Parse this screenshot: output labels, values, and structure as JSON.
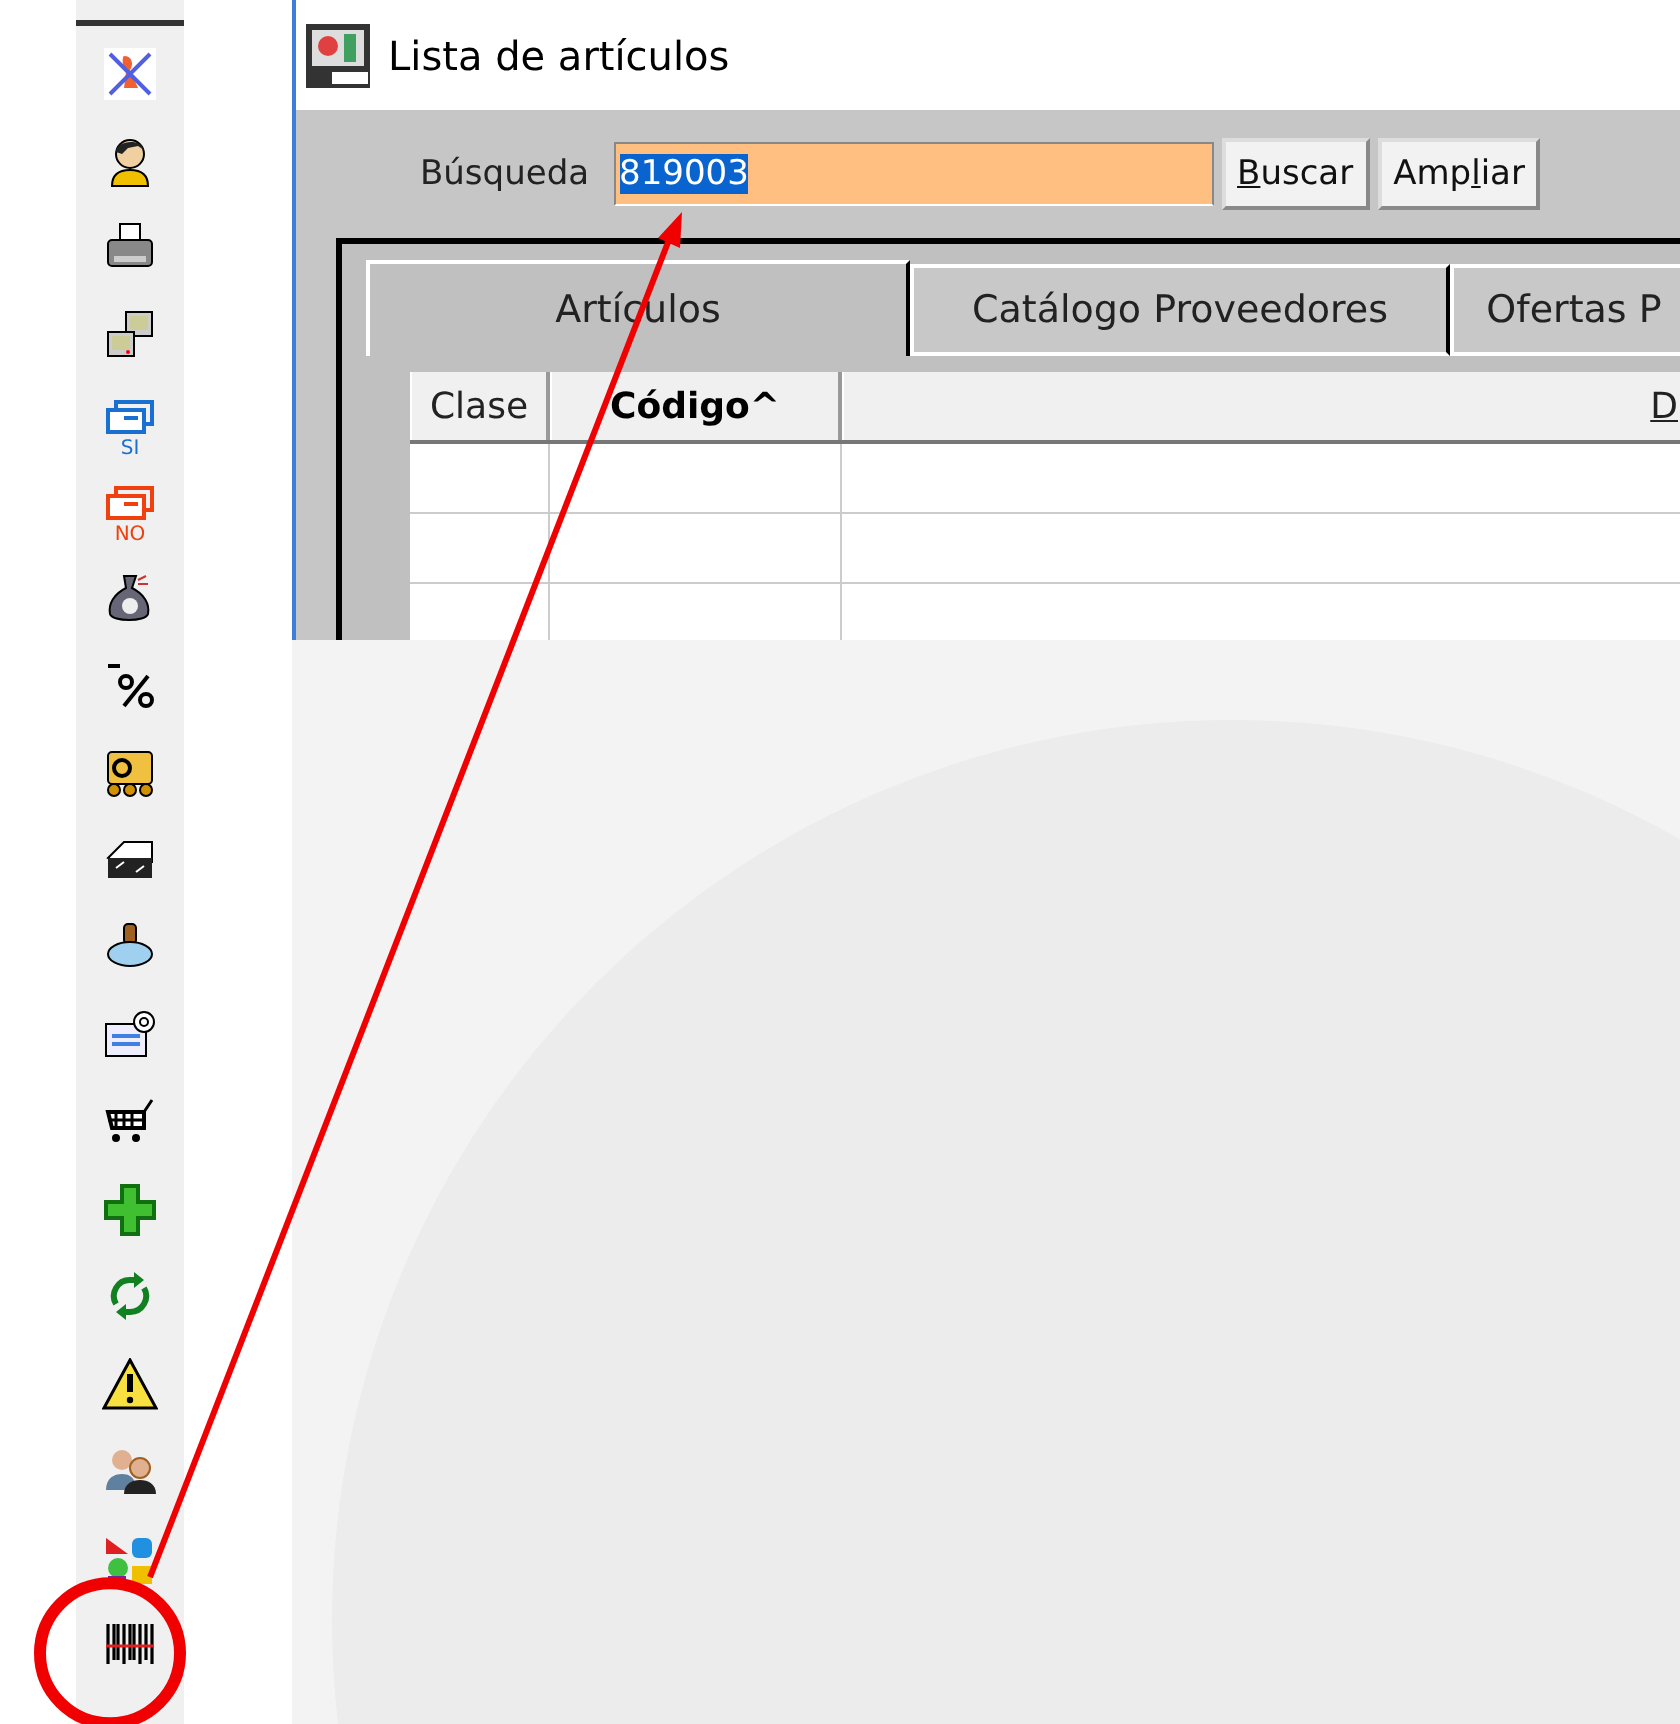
{
  "toolbar": {
    "items": [
      {
        "kind": "cancel-person"
      },
      {
        "kind": "person"
      },
      {
        "kind": "printer"
      },
      {
        "kind": "computers"
      },
      {
        "kind": "doc-yes",
        "label": "SI"
      },
      {
        "kind": "doc-no",
        "label": "NO"
      },
      {
        "kind": "money-bag"
      },
      {
        "kind": "percent"
      },
      {
        "kind": "card"
      },
      {
        "kind": "scanner"
      },
      {
        "kind": "stamp"
      },
      {
        "kind": "email-card"
      },
      {
        "kind": "cart"
      },
      {
        "kind": "plus"
      },
      {
        "kind": "refresh"
      },
      {
        "kind": "warning"
      },
      {
        "kind": "people"
      },
      {
        "kind": "shapes"
      },
      {
        "kind": "barcode",
        "highlighted": true
      }
    ]
  },
  "window": {
    "title": "Lista de artículos",
    "search": {
      "label": "Búsqueda",
      "value": "819003"
    },
    "buttons": [
      {
        "mnemonic": "B",
        "after": "uscar"
      },
      {
        "before": "Amp",
        "mnemonic": "l",
        "after": "iar"
      }
    ],
    "tabs": [
      {
        "label": "Artículos",
        "selected": true
      },
      {
        "label": "Catálogo Proveedores",
        "selected": false
      },
      {
        "label": "Ofertas P",
        "selected": false
      }
    ],
    "table": {
      "columns": [
        {
          "label": "Clase",
          "sorted": false
        },
        {
          "label": "Código^",
          "sorted": true
        },
        {
          "label": "D",
          "sorted": false
        }
      ]
    }
  }
}
